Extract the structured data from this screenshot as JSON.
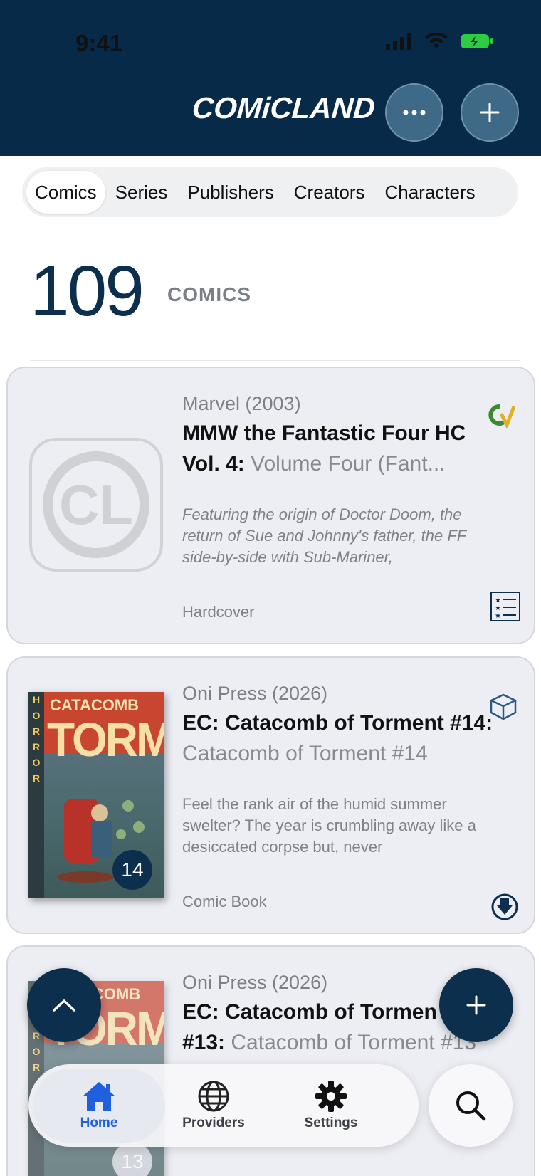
{
  "status_bar": {
    "time": "9:41"
  },
  "header": {
    "logo": "COMiCLAND"
  },
  "tabs": [
    {
      "label": "Comics",
      "active": true
    },
    {
      "label": "Series",
      "active": false
    },
    {
      "label": "Publishers",
      "active": false
    },
    {
      "label": "Creators",
      "active": false
    },
    {
      "label": "Characters",
      "active": false
    }
  ],
  "summary": {
    "count": "109",
    "label": "COMICS"
  },
  "comics": [
    {
      "publisher": "Marvel (2003)",
      "title": "MMW the Fantastic Four HC Vol. 4:",
      "subtitle": "Volume Four (Fant...",
      "description": "Featuring the origin of Doctor Doom, the return of Sue and Johnny's father, the FF side-by-side with Sub-Mariner,",
      "format": "Hardcover",
      "top_icon": "comicvine-icon",
      "bottom_icon": "star-list-icon",
      "cover": "placeholder-logo"
    },
    {
      "publisher": "Oni Press (2026)",
      "title": "EC: Catacomb of Torment #14:",
      "subtitle": "Catacomb of Torment #14",
      "description": "Feel the rank air of the humid summer swelter? The year is crumbling away like a desiccated corpse but, never",
      "format": "Comic Book",
      "issue": "14",
      "top_icon": "box-icon",
      "bottom_icon": "download-icon",
      "cover_text": {
        "side": "HORROR",
        "top": "CATACOMB",
        "big": "TORMENT"
      }
    },
    {
      "publisher": "Oni Press (2026)",
      "title": "EC: Catacomb of Tormen",
      "title_line2": "#13:",
      "subtitle": "Catacomb of Torment #13",
      "issue": "13",
      "cover_text": {
        "side": "HORROR",
        "top": "COMB",
        "big": "TORMENT"
      }
    }
  ],
  "tabbar": {
    "items": [
      {
        "label": "Home",
        "icon": "house-icon",
        "active": true
      },
      {
        "label": "Providers",
        "icon": "globe-icon",
        "active": false
      },
      {
        "label": "Settings",
        "icon": "gear-icon",
        "active": false
      }
    ]
  },
  "colors": {
    "header": "#062a48",
    "accent": "#0b2f4d",
    "active_tab": "#1f5fe0"
  }
}
